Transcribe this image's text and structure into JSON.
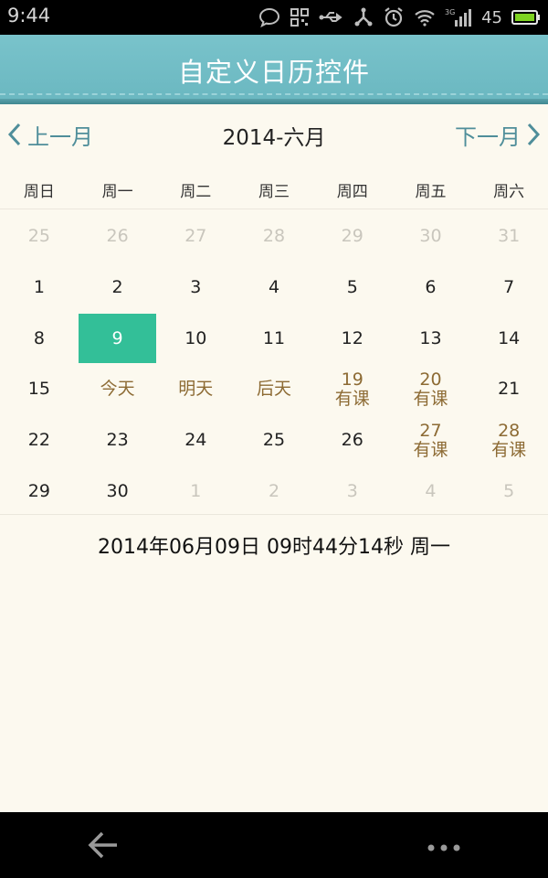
{
  "status_bar": {
    "time": "9:44",
    "battery_level": "45",
    "network": "3G",
    "icons": [
      "chat-bubble-icon",
      "qr-scan-icon",
      "usb-icon",
      "share-icon",
      "alarm-icon",
      "wifi-icon",
      "signal-icon",
      "battery-icon"
    ]
  },
  "title_bar": {
    "title": "自定义日历控件"
  },
  "month_nav": {
    "prev_label": "上一月",
    "next_label": "下一月",
    "current_month": "2014-六月"
  },
  "weekdays": [
    "周日",
    "周一",
    "周二",
    "周三",
    "周四",
    "周五",
    "周六"
  ],
  "weeks": [
    [
      {
        "d": "25",
        "t": "muted"
      },
      {
        "d": "26",
        "t": "muted"
      },
      {
        "d": "27",
        "t": "muted"
      },
      {
        "d": "28",
        "t": "muted"
      },
      {
        "d": "29",
        "t": "muted"
      },
      {
        "d": "30",
        "t": "muted"
      },
      {
        "d": "31",
        "t": "muted"
      }
    ],
    [
      {
        "d": "1"
      },
      {
        "d": "2"
      },
      {
        "d": "3"
      },
      {
        "d": "4"
      },
      {
        "d": "5"
      },
      {
        "d": "6"
      },
      {
        "d": "7"
      }
    ],
    [
      {
        "d": "8"
      },
      {
        "d": "9",
        "t": "selected"
      },
      {
        "d": "10"
      },
      {
        "d": "11"
      },
      {
        "d": "12"
      },
      {
        "d": "13"
      },
      {
        "d": "14"
      }
    ],
    [
      {
        "d": "15"
      },
      {
        "d": "今天",
        "t": "special"
      },
      {
        "d": "明天",
        "t": "special"
      },
      {
        "d": "后天",
        "t": "special"
      },
      {
        "d": "19",
        "t": "special",
        "note": "有课"
      },
      {
        "d": "20",
        "t": "special",
        "note": "有课"
      },
      {
        "d": "21"
      }
    ],
    [
      {
        "d": "22"
      },
      {
        "d": "23"
      },
      {
        "d": "24"
      },
      {
        "d": "25"
      },
      {
        "d": "26"
      },
      {
        "d": "27",
        "t": "special",
        "note": "有课"
      },
      {
        "d": "28",
        "t": "special",
        "note": "有课"
      }
    ],
    [
      {
        "d": "29"
      },
      {
        "d": "30"
      },
      {
        "d": "1",
        "t": "muted"
      },
      {
        "d": "2",
        "t": "muted"
      },
      {
        "d": "3",
        "t": "muted"
      },
      {
        "d": "4",
        "t": "muted"
      },
      {
        "d": "5",
        "t": "muted"
      }
    ]
  ],
  "selected_datetime": "2014年06月09日 09时44分14秒 周一",
  "colors": {
    "title_bar": "#6ab7c0",
    "nav_text": "#4f8e9a",
    "selected_day": "#33bf98",
    "special_text": "#8d6b34",
    "muted_text": "#c9c6bd",
    "background": "#fcf9ef"
  },
  "bottom_nav": {
    "icons": [
      "back-arrow-icon",
      "more-dots-icon"
    ]
  }
}
